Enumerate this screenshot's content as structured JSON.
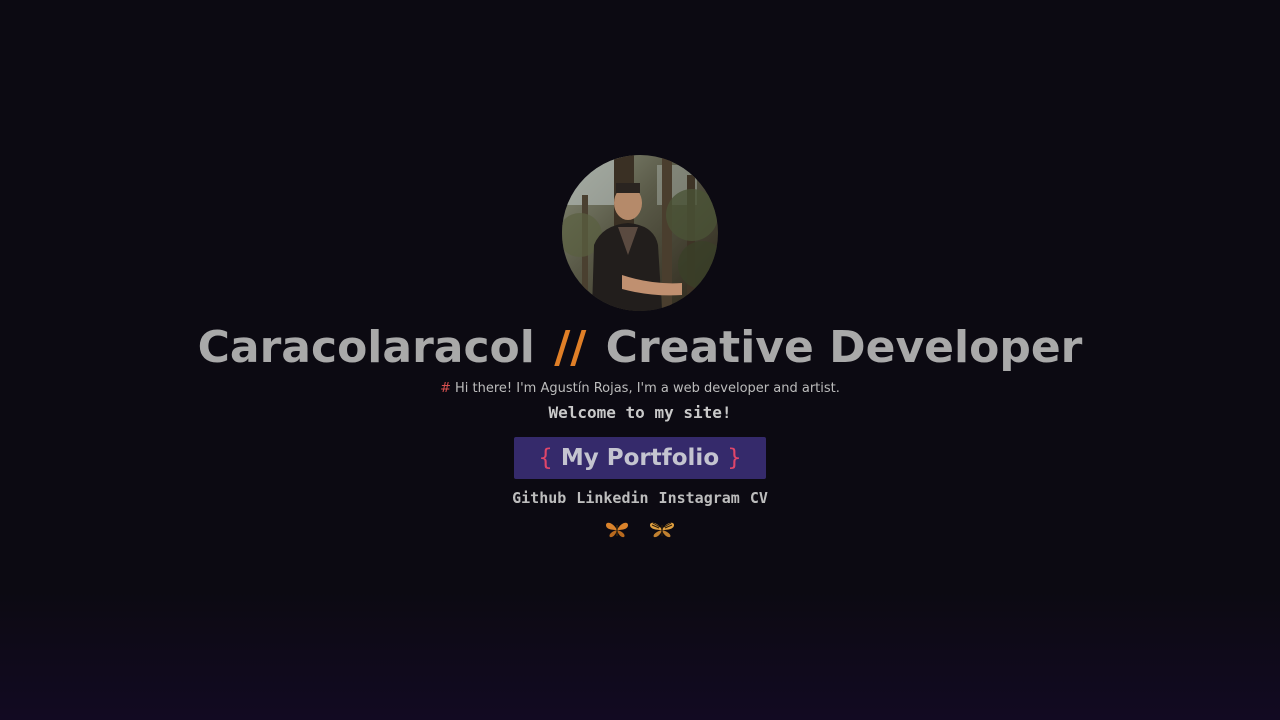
{
  "profile": {
    "photo_alt": "Agustín Rojas"
  },
  "header": {
    "title_left": "Caracolaracol",
    "title_sep": "//",
    "title_right": "Creative Developer"
  },
  "intro": {
    "hash": "#",
    "text": "Hi there! I'm Agustín Rojas, I'm a web developer and artist."
  },
  "welcome": "Welcome to my site!",
  "portfolio_button": {
    "brace_open": "{",
    "label": "My Portfolio",
    "brace_close": "}"
  },
  "links": [
    {
      "label": "Github"
    },
    {
      "label": "Linkedin"
    },
    {
      "label": "Instagram"
    },
    {
      "label": "CV"
    }
  ],
  "butterflies": [
    {
      "icon": "orange-butterfly-icon",
      "color": "#d9822b"
    },
    {
      "icon": "striped-butterfly-icon",
      "color": "#e0a040"
    }
  ],
  "colors": {
    "background": "#0c0a12",
    "accent_orange": "#e07f27",
    "accent_pink": "#e0466a",
    "button_bg": "#352a6b"
  }
}
